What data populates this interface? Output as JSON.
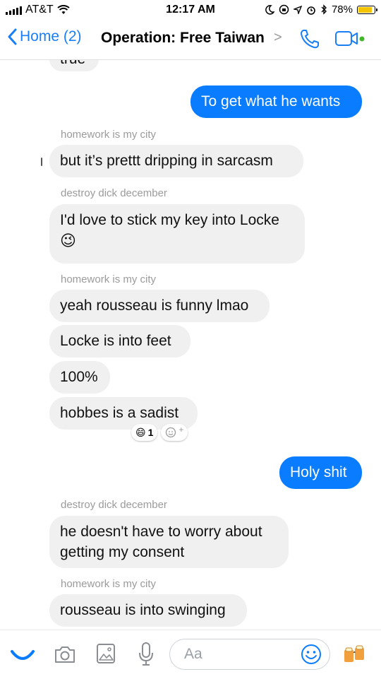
{
  "status_bar": {
    "carrier": "AT&T",
    "time": "12:17 AM",
    "battery_percent": "78%",
    "battery_level": 0.78,
    "battery_color": "#f5c400"
  },
  "nav": {
    "back_label": "Home (2)",
    "title": "Operation: Free Taiwan",
    "chevron": ">",
    "icons": [
      "phone-icon",
      "video-camera-icon"
    ],
    "accent_color": "#1a7ff6"
  },
  "messages": {
    "partial_top": "true",
    "m1": "To get what he wants",
    "sender_homework": "homework is my city",
    "m2": "but it’s prettt dripping in sarcasm",
    "sender_destroy": "destroy dick december",
    "m3": "I'd love to stick my key into Locke",
    "m3_emoji": "😉",
    "sender_homework_2": "homework is my city",
    "m4": "yeah rousseau is funny lmao",
    "m5": "Locke is into feet",
    "m6": "100%",
    "m7": "hobbes is a sadist",
    "reaction_emoji": "😄",
    "reaction_count": "1",
    "add_reaction": "+",
    "m8": "Holy shit",
    "sender_destroy_2": "destroy dick december",
    "m9_line1": "he doesn't have to worry about",
    "m9_line2": "getting my consent",
    "sender_homework_3": "homework is my city",
    "m10": "rousseau is into swinging"
  },
  "composer": {
    "placeholder": "Aa",
    "icons": [
      "more-icon",
      "camera-icon",
      "image-icon",
      "microphone-icon",
      "emoji-icon",
      "sticker-icon"
    ]
  },
  "colors": {
    "outgoing_bubble": "#0a7cff",
    "incoming_bubble": "#f1f0f0",
    "sender_text": "#9b9b9b"
  }
}
